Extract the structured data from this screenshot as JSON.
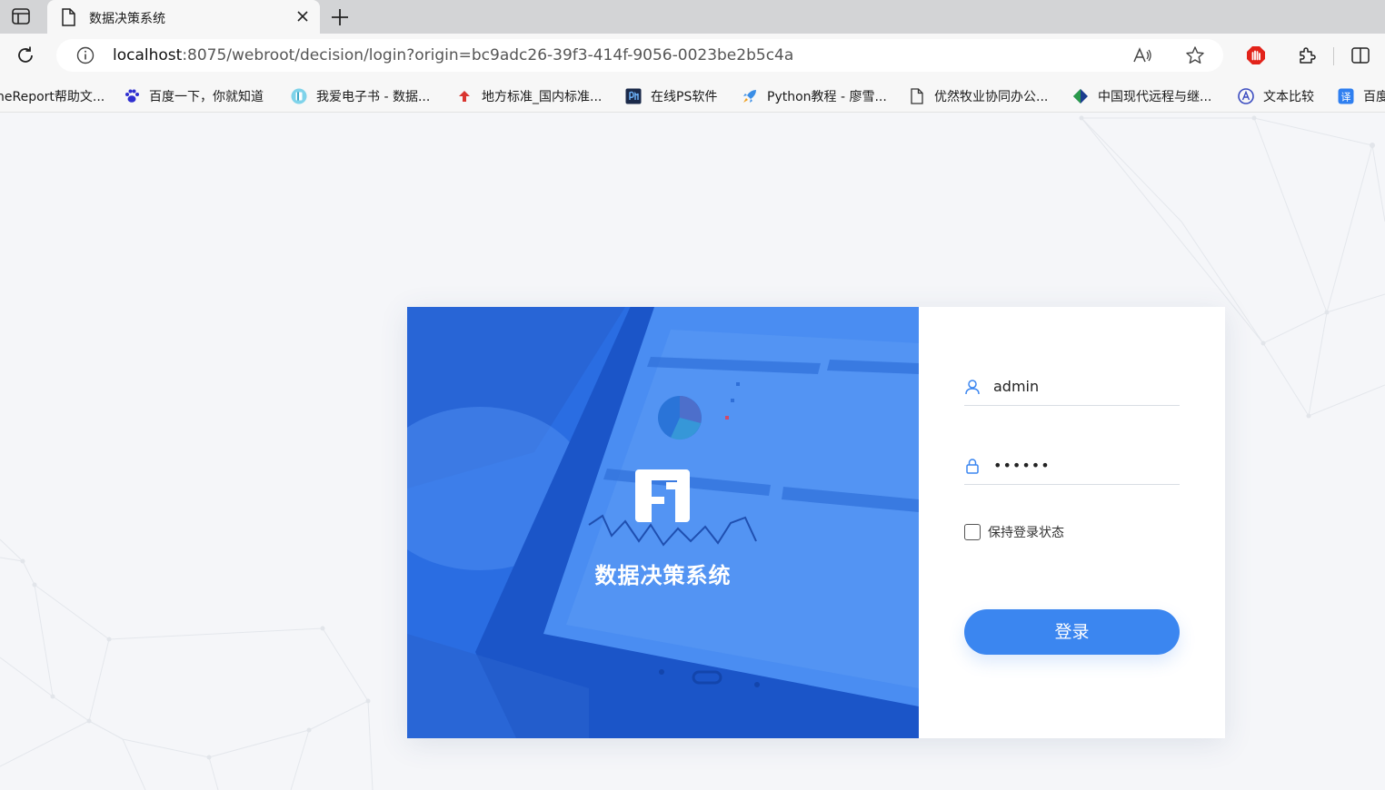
{
  "browser": {
    "tab": {
      "title": "数据决策系统"
    },
    "url": {
      "host": "localhost",
      "rest": ":8075/webroot/decision/login?origin=bc9adc26-39f3-414f-9056-0023be2b5c4a"
    },
    "bookmarks": [
      {
        "label": "neReport帮助文...",
        "icon": "finereport-icon",
        "color": "#4a90d9"
      },
      {
        "label": "百度一下，你就知道",
        "icon": "baidu-paw-icon",
        "color": "#2f2fd0"
      },
      {
        "label": "我爱电子书 - 数据...",
        "icon": "book-icon",
        "color": "#5bc0de"
      },
      {
        "label": "地方标准_国内标准...",
        "icon": "standard-icon",
        "color": "#d9352f"
      },
      {
        "label": "在线PS软件",
        "icon": "ps-icon",
        "color": "#1b2a4a"
      },
      {
        "label": "Python教程 - 廖雪...",
        "icon": "rocket-icon",
        "color": "#3a8ee6"
      },
      {
        "label": "优然牧业协同办公...",
        "icon": "page-icon",
        "color": "#555555"
      },
      {
        "label": "中国现代远程与继...",
        "icon": "diamond-icon",
        "color": "#1b3d8f"
      },
      {
        "label": "文本比较",
        "icon": "compare-icon",
        "color": "#3b4cc0"
      },
      {
        "label": "百度",
        "icon": "translate-icon",
        "color": "#2f7ff0"
      }
    ]
  },
  "login": {
    "app_name": "数据决策系统",
    "username": "admin",
    "password_mask": "••••••",
    "remember_label": "保持登录状态",
    "submit_label": "登录"
  },
  "colors": {
    "accent": "#3b86f0",
    "hero": "#2b6ce0"
  }
}
